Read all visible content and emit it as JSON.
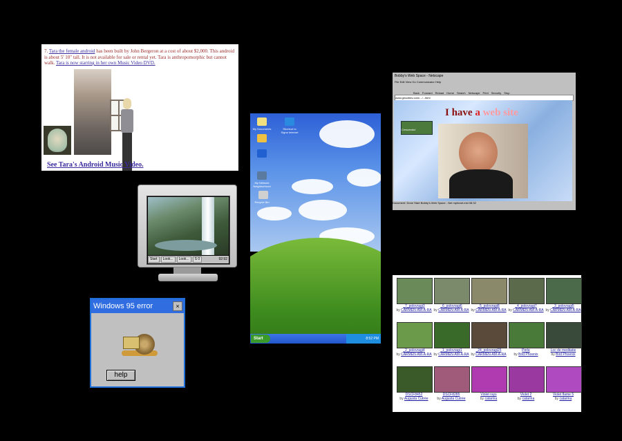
{
  "tara": {
    "text_prefix": "7.",
    "link_female": "Tara the female android",
    "text_mid": "has been built by John Bergeron at a cost of about $2,000. This android is about 5' 10\" tall. It is not available for sale or rental yet. Tara is anthropomorphic but cannot walk.",
    "link_starring": "Tara is now starring in her own Music Video DVD.",
    "music_link": "See Tara's Android Music Video."
  },
  "crt": {
    "taskbar": {
      "start": "Start",
      "btn1": "Look...",
      "btn2": "Look...",
      "btn3": "S 0",
      "clock": "92:92"
    }
  },
  "error_dialog": {
    "title": "Windows 95 error",
    "close_glyph": "×",
    "help_label": "help"
  },
  "xp_desktop": {
    "icons": [
      "My Documents",
      "Shortcut to Signa Internet",
      "",
      "",
      "My Network Neighborhood",
      "Recycle Bin"
    ],
    "start_label": "Start",
    "clock": "8:52 PM"
  },
  "bobby": {
    "title": "Bobby's Web Space - Netscape",
    "menu": [
      "File",
      "Edit",
      "View",
      "Go",
      "Communicator",
      "Help"
    ],
    "tools": [
      "Back",
      "Forward",
      "Reload",
      "Home",
      "Search",
      "Netscape",
      "Print",
      "Security",
      "Stop"
    ],
    "address": "www.geocities.com/.../...html",
    "player_title": "Crescendo!",
    "heading_a": "I have ",
    "heading_b": "a ",
    "heading_c": "web site",
    "status": "Document: Done",
    "taskbar_start": "Start",
    "taskbar_btn1": "Bobby's Web Space - Net",
    "taskbar_btn2": "mpheart.mid",
    "taskbar_clock": "08:32"
  },
  "gallery": {
    "items": [
      {
        "title": "_7_polovragi3",
        "by": "by",
        "author": "CARMEN-AM-A-RA"
      },
      {
        "title": "_6_polovragi6",
        "by": "by",
        "author": "CARMEN-AM-A-RA"
      },
      {
        "title": "_5_polovragi8",
        "by": "by",
        "author": "CARMEN-AM-A-RA"
      },
      {
        "title": "_4_polovragi7",
        "by": "by",
        "author": "CARMEN-AM-A-RA"
      },
      {
        "title": "_3_polovragi5",
        "by": "by",
        "author": "CARMEN-AM-A-RA"
      },
      {
        "title": "_2_polovragi4",
        "by": "by",
        "author": "CARMEN-AM-A-RA"
      },
      {
        "title": "_1_polovragi1",
        "by": "by",
        "author": "CARMEN-AM-A-RA"
      },
      {
        "title": "_24_polovragi25",
        "by": "by",
        "author": "CARMEN-AM-A-RA"
      },
      {
        "title": "Perle",
        "by": "by",
        "author": "Bird Phoenix"
      },
      {
        "title": "Loc de meditatie",
        "by": "by",
        "author": "Bird Phoenix"
      },
      {
        "title": "DSCF8452",
        "by": "by",
        "author": "Augusta Cutrée"
      },
      {
        "title": "DSCF8285",
        "by": "by",
        "author": "Augusta Cutrée"
      },
      {
        "title": "Violet rays",
        "by": "by",
        "author": "catarina"
      },
      {
        "title": "Violet 2",
        "by": "by",
        "author": "catarina"
      },
      {
        "title": "Violet flame 5",
        "by": "by",
        "author": "catarina"
      }
    ]
  }
}
